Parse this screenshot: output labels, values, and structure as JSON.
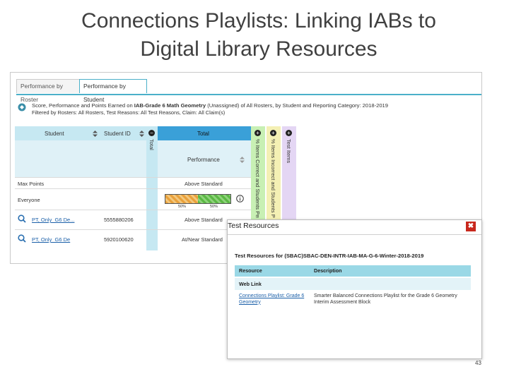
{
  "slide": {
    "title_line1": "Connections Playlists: Linking IABs to",
    "title_line2": "Digital Library Resources",
    "page_number": "43"
  },
  "tabs": {
    "roster": "Performance by Roster",
    "student": "Performance by Student"
  },
  "description": {
    "prefix": "Score, Performance and Points Earned on ",
    "assessment": "IAB-Grade 6 Math Geometry",
    "suffix": " (Unassigned) of All Rosters, by Student and Reporting Category: 2018-2019",
    "filter_line": "Filtered by Rosters: All Rosters, Test Reasons: All Test Reasons, Claim: All Claim(s)"
  },
  "grid": {
    "col_student": "Student",
    "col_student_id": "Student ID",
    "col_total_vertical": "Total",
    "col_total": "Total",
    "col_pct_vertical": "% Items Correct and Students Perfor...",
    "col_pct2_vertical": "% Items Incorrect and Students Perfor...",
    "col_test_items_vertical": "Test Items",
    "performance_header": "Performance",
    "max_points_label": "Max Points",
    "max_points_value": "Above Standard",
    "everyone_label": "Everyone",
    "bar_left_pct": "50%",
    "bar_right_pct": "50%",
    "bar_left_fraction": 0.5,
    "rows": [
      {
        "name": "PT, Only_G6 De...",
        "id": "5555880206",
        "performance": "Above Standard"
      },
      {
        "name": "PT, Only_G6 De",
        "id": "5920100620",
        "performance": "At/Near Standard"
      }
    ]
  },
  "modal": {
    "title": "Test Resources",
    "close_glyph": "✖",
    "subtitle": "Test Resources for (SBAC)SBAC-DEN-INTR-IAB-MA-G-6-Winter-2018-2019",
    "col_resource": "Resource",
    "col_description": "Description",
    "group_label": "Web Link",
    "resource_link_line1": "Connections Playlist: Grade 6",
    "resource_link_line2": "Geometry",
    "resource_desc_line1": "Smarter Balanced Connections Playlist for the Grade 6 Geometry",
    "resource_desc_line2": "Interim Assessment Block"
  },
  "colors": {
    "header_blue": "#c6e8f2",
    "total_blue": "#3aa0d8",
    "pct_green": "#c8f0b4",
    "pct2_yellow": "#f4f0b4",
    "test_items_purple": "#e4d6f4",
    "close_red": "#c8281d",
    "bar_orange": "#e9a13b",
    "bar_green": "#5bb844"
  },
  "icons": [
    "search-icon",
    "sort-icon",
    "minus-circle-icon",
    "plus-circle-icon",
    "info-icon",
    "close-icon"
  ]
}
